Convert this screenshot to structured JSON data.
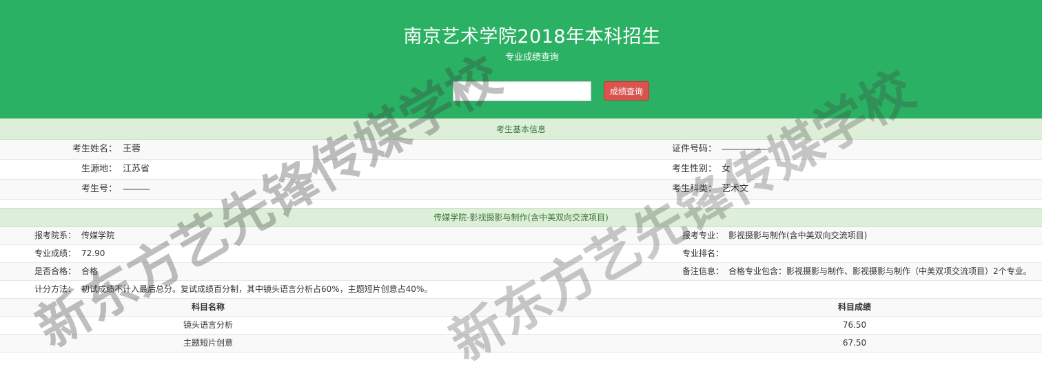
{
  "header": {
    "title": "南京艺术学院2018年本科招生",
    "subtitle": "专业成绩查询",
    "search_value": "",
    "query_button": "成绩查询"
  },
  "basic_info": {
    "section_title": "考生基本信息",
    "name_label": "考生姓名：",
    "name_value": "王蓉",
    "id_label": "证件号码：",
    "id_value": "----------------------",
    "origin_label": "生源地：",
    "origin_value": "江苏省",
    "gender_label": "考生性别：",
    "gender_value": "女",
    "exam_no_label": "考生号：",
    "exam_no_value": "-------------",
    "category_label": "考生科类：",
    "category_value": "艺术文"
  },
  "department": {
    "section_title": "传媒学院-影视摄影与制作(含中美双向交流项目)",
    "dept_label": "报考院系：",
    "dept_value": "传媒学院",
    "major_label": "报考专业：",
    "major_value": "影视摄影与制作(含中美双向交流项目)",
    "score_label": "专业成绩：",
    "score_value": "72.90",
    "rank_label": "专业排名：",
    "rank_value": "",
    "pass_label": "是否合格：",
    "pass_value": "合格",
    "note_label": "备注信息：",
    "note_value": "合格专业包含：影视摄影与制作、影视摄影与制作（中美双项交流项目）2个专业。",
    "method_label": "计分方法：",
    "method_value": "初试成绩不计入最后总分。复试成绩百分制，其中镜头语言分析占60%，主题短片创意占40%。"
  },
  "scores_table": {
    "col_subject": "科目名称",
    "col_score": "科目成绩",
    "rows": [
      {
        "subject": "镜头语言分析",
        "score": "76.50"
      },
      {
        "subject": "主题短片创意",
        "score": "67.50"
      }
    ]
  },
  "watermark": {
    "text_1": "新东方艺先锋传媒学校",
    "text_2": "新东方艺先锋传媒学校"
  }
}
